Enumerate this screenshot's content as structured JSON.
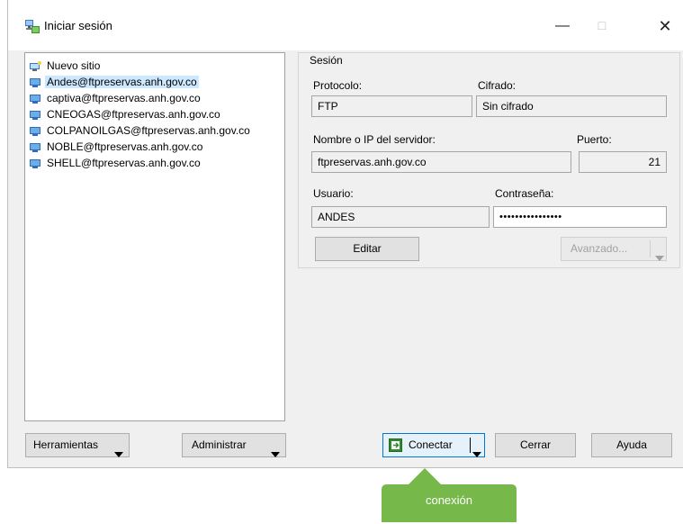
{
  "window": {
    "title": "Iniciar sesión",
    "icon": "filezilla-sitemanager-icon",
    "controls": [
      "minimize-icon",
      "maximize-icon",
      "close-icon"
    ],
    "minimize_glyph": "—",
    "maximize_glyph": "☐",
    "close_glyph": "✕"
  },
  "site_list": {
    "new_site": "Nuevo sitio",
    "items": [
      {
        "label": "Andes@ftpreservas.anh.gov.co",
        "selected": true
      },
      {
        "label": "captiva@ftpreservas.anh.gov.co",
        "selected": false
      },
      {
        "label": "CNEOGAS@ftpreservas.anh.gov.co",
        "selected": false
      },
      {
        "label": "COLPANOILGAS@ftpreservas.anh.gov.co",
        "selected": false
      },
      {
        "label": "NOBLE@ftpreservas.anh.gov.co",
        "selected": false
      },
      {
        "label": "SHELL@ftpreservas.anh.gov.co",
        "selected": false
      }
    ]
  },
  "session": {
    "legend": "Sesión",
    "protocol_label": "Protocolo:",
    "protocol_value": "FTP",
    "encryption_label": "Cifrado:",
    "encryption_value": "Sin cifrado",
    "host_label": "Nombre o IP del servidor:",
    "host_value": "ftpreservas.anh.gov.co",
    "port_label": "Puerto:",
    "port_value": "21",
    "user_label": "Usuario:",
    "user_value": "ANDES",
    "password_label": "Contraseña:",
    "password_value": "••••••••••••••••",
    "edit_button": "Editar",
    "advanced_button": "Avanzado..."
  },
  "footer": {
    "tools_button": "Herramientas",
    "manage_button": "Administrar",
    "connect_button": "Conectar",
    "close_button": "Cerrar",
    "help_button": "Ayuda"
  },
  "callout": {
    "text": "conexión",
    "color": "#77b84a"
  }
}
